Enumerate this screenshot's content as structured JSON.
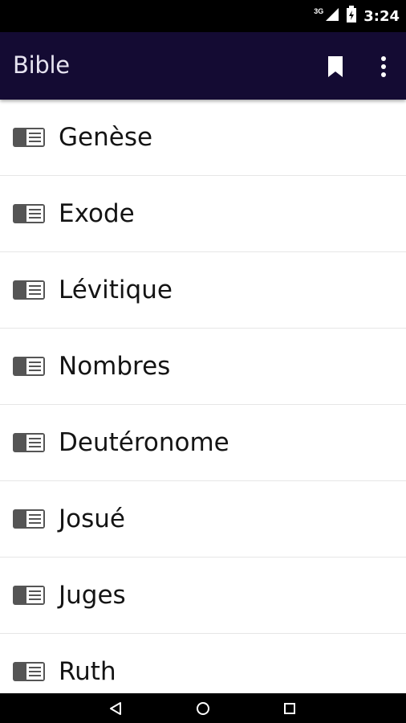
{
  "status_bar": {
    "network": "3G",
    "time": "3:24"
  },
  "app_bar": {
    "title": "Bible",
    "actions": [
      {
        "icon": "bookmark-icon"
      },
      {
        "icon": "more-vert-icon"
      }
    ]
  },
  "books": [
    {
      "label": "Genèse"
    },
    {
      "label": "Exode"
    },
    {
      "label": "Lévitique"
    },
    {
      "label": "Nombres"
    },
    {
      "label": "Deutéronome"
    },
    {
      "label": "Josué"
    },
    {
      "label": "Juges"
    },
    {
      "label": "Ruth"
    }
  ],
  "nav_bar": {
    "buttons": [
      "back",
      "home",
      "recents"
    ]
  },
  "colors": {
    "app_bar_bg": "#140b33",
    "status_bar_bg": "#000000",
    "divider": "#e6e6e6",
    "icon_gray": "#555555"
  }
}
